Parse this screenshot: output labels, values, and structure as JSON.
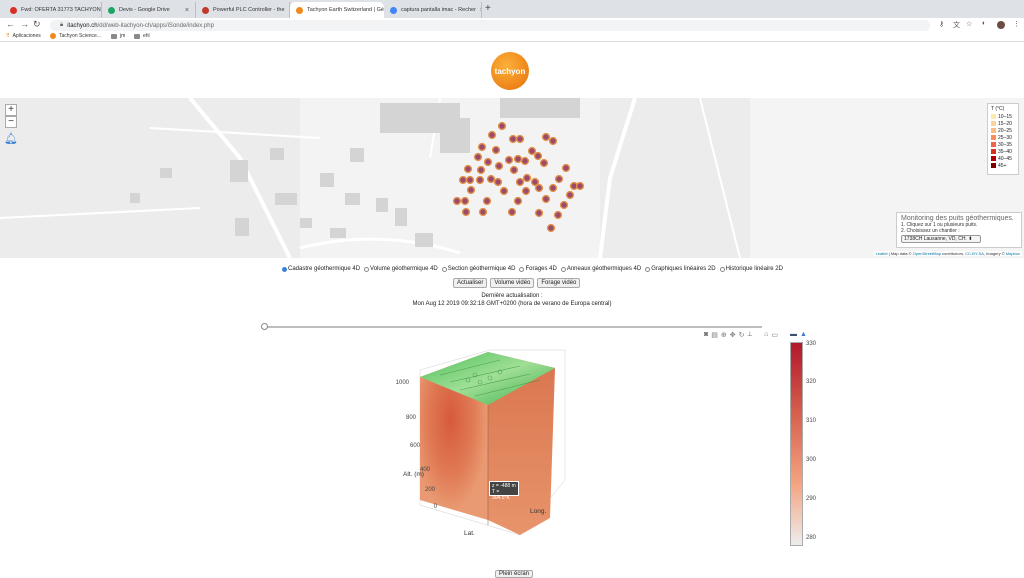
{
  "browser": {
    "tabs": [
      {
        "label": "Fwd: OFERTA 31773 TACHYON",
        "icon": "gmail-icon",
        "color": "#d93025"
      },
      {
        "label": "Devis - Google Drive",
        "icon": "drive-icon",
        "color": "#1fa463"
      },
      {
        "label": "Powerful PLC Controller - the",
        "icon": "plc-icon",
        "color": "#c0392b"
      },
      {
        "label": "Tachyon Earth Switzerland | Gé",
        "icon": "tachyon-icon",
        "color": "#f08a1c"
      },
      {
        "label": "captura pantalla imac - Recher",
        "icon": "google-icon",
        "color": "#4285f4"
      }
    ],
    "url_host": "itachyon.ch",
    "url_path": "/dd/web-itachyon-ch/apps/iSonde/index.php",
    "bookmarks": [
      "Aplicaciones",
      "Tachyon Science...",
      "jm",
      "ehl"
    ]
  },
  "logo_text": "tachyon",
  "map": {
    "legend_title": "T (°C)",
    "legend": [
      {
        "label": "10–15",
        "color": "#fde9a8"
      },
      {
        "label": "15–20",
        "color": "#fdd49e"
      },
      {
        "label": "20–25",
        "color": "#fdbb84"
      },
      {
        "label": "25–30",
        "color": "#fc8d59"
      },
      {
        "label": "30–35",
        "color": "#ef6548"
      },
      {
        "label": "35–40",
        "color": "#d7301f"
      },
      {
        "label": "40–45",
        "color": "#b30000"
      },
      {
        "label": "45+",
        "color": "#7f0000"
      }
    ],
    "info_title": "Monitoring des puits géothermiques.",
    "info_step1": "1. Cliquez sur 1 ou plusieurs puits.",
    "info_step2": "2. Choisissez un chantier :",
    "site_value": "1738CH Lausanne, VD, CH.",
    "attrib_leaflet": "Leaflet",
    "attrib_mid": " | Map data © ",
    "attrib_osm": "OpenStreetMap",
    "attrib_contrib": " contributors, ",
    "attrib_cc": "CC-BY-SA",
    "attrib_imagery": ", Imagery © ",
    "attrib_mapbox": "Mapbox"
  },
  "views": [
    {
      "label": "Cadastre géothermique 4D",
      "selected": true
    },
    {
      "label": "Volume géothermique 4D",
      "selected": false
    },
    {
      "label": "Section géothermique 4D",
      "selected": false
    },
    {
      "label": "Forages 4D",
      "selected": false
    },
    {
      "label": "Anneaux géothermiques 4D",
      "selected": false
    },
    {
      "label": "Graphiques linéaires 2D",
      "selected": false
    },
    {
      "label": "Historique linéaire 2D",
      "selected": false
    }
  ],
  "buttons": {
    "refresh": "Actualiser",
    "volume_video": "Volume vidéo",
    "drill_video": "Forage vidéo",
    "fullscreen": "Plein écran"
  },
  "update_label": "Dernière actualisation :",
  "update_time": "Mon Aug 12 2019 09:32:18 GMT+0200 (hora de verano de Europa central)",
  "plot": {
    "z_ticks": [
      "1000",
      "800",
      "600",
      "400",
      "200",
      "0"
    ],
    "z_label": "Alt. (m)",
    "x_label": "Lat.",
    "y_label": "Long.",
    "tooltip_z": "z = -488 m",
    "tooltip_t": "T = 304.5°K",
    "colorbar_ticks": [
      "330",
      "320",
      "310",
      "300",
      "290",
      "280"
    ]
  }
}
